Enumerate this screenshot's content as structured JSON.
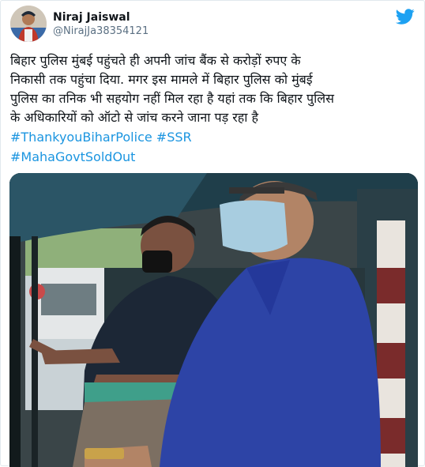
{
  "author": {
    "display_name": "Niraj Jaiswal",
    "handle": "@NirajJa38354121",
    "avatar_icon": "user-avatar"
  },
  "platform_icon": "twitter-bird-icon",
  "brand_color": "#1da1f2",
  "link_color": "#1b95e0",
  "tweet": {
    "text": "बिहार पुलिस मुंबई पहुंचते ही अपनी जांच बैंक से करोड़ों रुपए के\nनिकासी तक पहुंचा दिया. मगर इस मामले में बिहार पुलिस को मुंबई\nपुलिस का तनिक भी सहयोग नहीं मिल रहा है यहां तक कि बिहार पुलिस\nके अधिकारियों को ऑटो से जांच करने जाना पड़ रहा है",
    "hashtags": [
      "#ThankyouBiharPolice",
      "#SSR",
      "#MahaGovtSoldOut"
    ]
  }
}
